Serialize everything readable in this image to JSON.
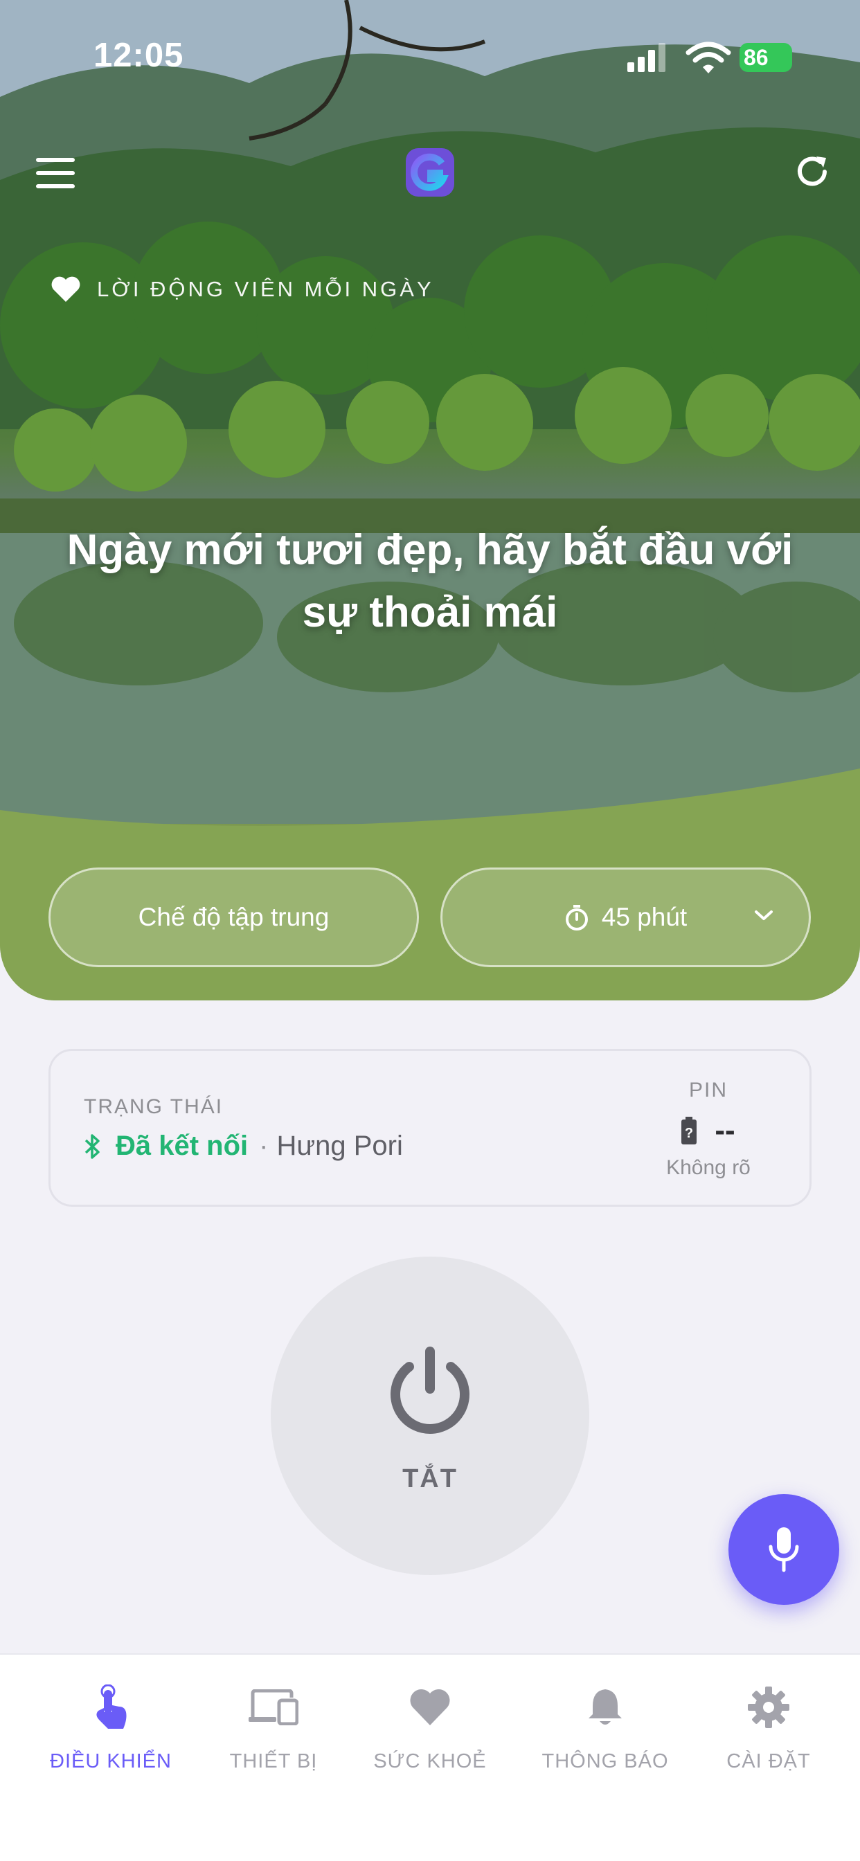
{
  "status_bar": {
    "time": "12:05",
    "battery": "86"
  },
  "hero": {
    "encourage_label": "LỜI ĐỘNG VIÊN MỖI NGÀY",
    "quote": "Ngày mới tươi đẹp, hãy bắt đầu với sự thoải mái",
    "focus_mode_label": "Chế độ tập trung",
    "timer_label": "45 phút"
  },
  "status_card": {
    "label": "TRẠNG THÁI",
    "connection": "Đã kết nối",
    "separator": "·",
    "device_name": "Hưng Pori",
    "pin_label": "PIN",
    "pin_value": "--",
    "pin_sub": "Không rõ"
  },
  "power": {
    "label": "TẮT"
  },
  "tabs": [
    {
      "label": "ĐIỀU KHIỂN",
      "icon": "tap-hand-icon",
      "active": true
    },
    {
      "label": "THIẾT BỊ",
      "icon": "devices-icon",
      "active": false
    },
    {
      "label": "SỨC KHOẺ",
      "icon": "heart-icon",
      "active": false
    },
    {
      "label": "THÔNG BÁO",
      "icon": "bell-icon",
      "active": false
    },
    {
      "label": "CÀI ĐẶT",
      "icon": "gear-icon",
      "active": false
    }
  ],
  "colors": {
    "accent": "#6a5cf7",
    "connected": "#22b573",
    "battery_green": "#34c759",
    "inactive_tab": "#a3a3ab"
  }
}
